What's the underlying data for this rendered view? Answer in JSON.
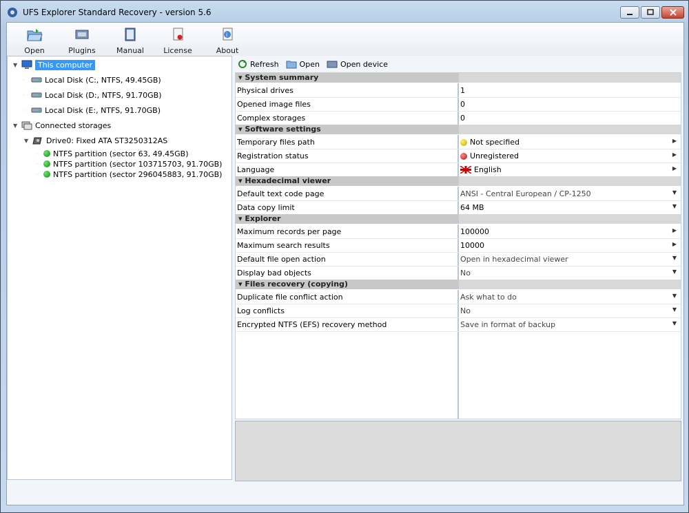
{
  "window": {
    "title": "UFS Explorer Standard Recovery - version 5.6"
  },
  "toolbar": {
    "items": [
      {
        "label": "Open",
        "icon": "open-folder-icon"
      },
      {
        "label": "Plugins",
        "icon": "plugins-icon"
      },
      {
        "label": "Manual",
        "icon": "manual-book-icon"
      },
      {
        "label": "License",
        "icon": "license-icon"
      },
      {
        "label": "About",
        "icon": "about-icon"
      }
    ]
  },
  "tree": {
    "this_computer": "This computer",
    "disks": [
      "Local Disk (C:, NTFS, 49.45GB)",
      "Local Disk (D:, NTFS, 91.70GB)",
      "Local Disk (E:, NTFS, 91.70GB)"
    ],
    "connected_storages": "Connected storages",
    "drive": "Drive0: Fixed ATA ST3250312AS",
    "partitions": [
      "NTFS partition (sector 63, 49.45GB)",
      "NTFS partition (sector 103715703, 91.70GB)",
      "NTFS partition (sector 296045883, 91.70GB)"
    ]
  },
  "right_toolbar": {
    "refresh": "Refresh",
    "open": "Open",
    "open_device": "Open device"
  },
  "sections": {
    "system_summary": {
      "title": "System summary",
      "rows": [
        {
          "key": "Physical drives",
          "value": "1"
        },
        {
          "key": "Opened image files",
          "value": "0"
        },
        {
          "key": "Complex storages",
          "value": "0"
        }
      ]
    },
    "software_settings": {
      "title": "Software settings",
      "rows": [
        {
          "key": "Temporary files path",
          "value": "Not specified"
        },
        {
          "key": "Registration status",
          "value": "Unregistered"
        },
        {
          "key": "Language",
          "value": "English"
        }
      ]
    },
    "hex_viewer": {
      "title": "Hexadecimal viewer",
      "rows": [
        {
          "key": "Default text code page",
          "value": "ANSI - Central European / CP-1250"
        },
        {
          "key": "Data copy limit",
          "value": "64 MB"
        }
      ]
    },
    "explorer": {
      "title": "Explorer",
      "rows": [
        {
          "key": "Maximum records per page",
          "value": "100000"
        },
        {
          "key": "Maximum search results",
          "value": "10000"
        },
        {
          "key": "Default file open action",
          "value": "Open in hexadecimal viewer"
        },
        {
          "key": "Display bad objects",
          "value": "No"
        }
      ]
    },
    "files_recovery": {
      "title": "Files recovery (copying)",
      "rows": [
        {
          "key": "Duplicate file conflict action",
          "value": "Ask what to do"
        },
        {
          "key": "Log conflicts",
          "value": "No"
        },
        {
          "key": "Encrypted NTFS (EFS) recovery method",
          "value": "Save in format of backup"
        }
      ]
    }
  },
  "colors": {
    "selection": "#3399ff",
    "status_yellow": "#e0d000",
    "status_red": "#d42020",
    "partition_green": "#1aa01a"
  }
}
